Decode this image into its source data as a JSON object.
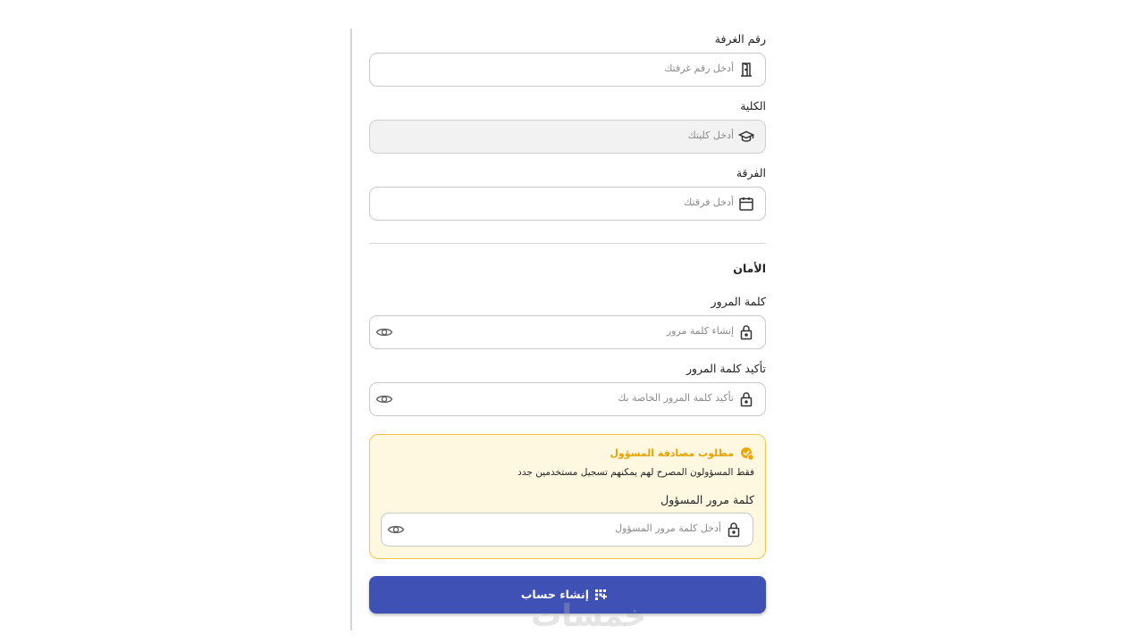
{
  "fields": {
    "room": {
      "label": "رقم الغرفة",
      "placeholder": "أدخل رقم غرفتك",
      "icon": "door-icon"
    },
    "faculty": {
      "label": "الكلية",
      "placeholder": "أدخل كليتك",
      "icon": "graduation-cap-icon"
    },
    "year": {
      "label": "الفرقة",
      "placeholder": "أدخل فرقتك",
      "icon": "calendar-icon"
    }
  },
  "security": {
    "title": "الأمان",
    "password": {
      "label": "كلمة المرور",
      "placeholder": "إنشاء كلمة مرور",
      "icon": "lock-icon"
    },
    "confirm": {
      "label": "تأكيد كلمة المرور",
      "placeholder": "تأكيد كلمة المرور الخاصة بك",
      "icon": "lock-icon"
    }
  },
  "admin": {
    "title": "مطلوب مصادقة المسؤول",
    "description": "فقط المسؤولون المصرح لهم يمكنهم تسجيل مستخدمين جدد",
    "label": "كلمة مرور المسؤول",
    "placeholder": "أدخل كلمة مرور المسؤول",
    "accent": "#e9a200",
    "background": "#fff8e1"
  },
  "submit": {
    "label": "إنشاء حساب",
    "color": "#3f51b5"
  },
  "watermark": "خمسات"
}
